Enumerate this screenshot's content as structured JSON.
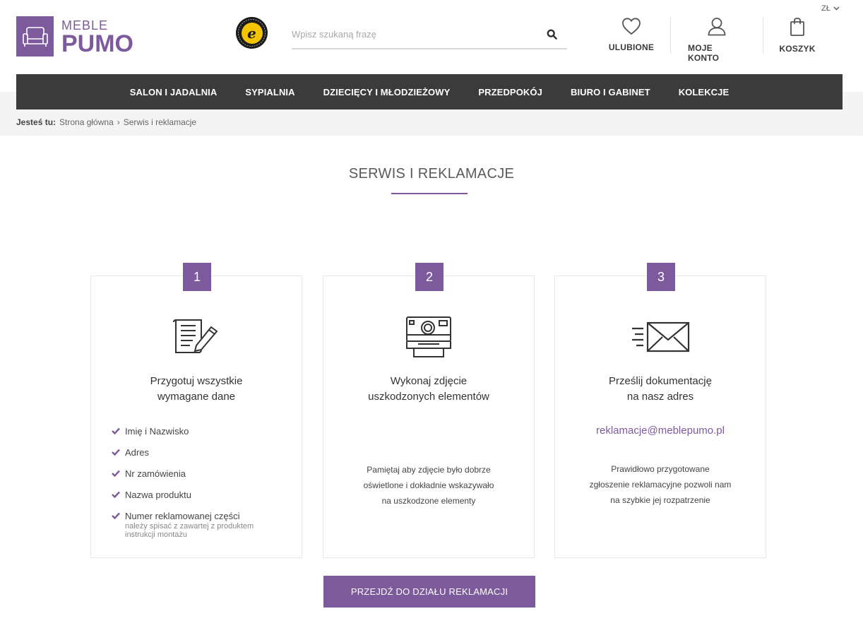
{
  "logo": {
    "line1": "MEBLE",
    "line2": "PUMO"
  },
  "trusted_badge": {
    "letter": "e"
  },
  "search": {
    "placeholder": "Wpisz szukaną frazę",
    "value": ""
  },
  "currency": {
    "label": "ZŁ"
  },
  "header_actions": [
    {
      "label": "ULUBIONE",
      "icon": "heart-icon"
    },
    {
      "label": "MOJE KONTO",
      "icon": "user-icon"
    },
    {
      "label": "KOSZYK",
      "icon": "shopping-bag-icon"
    }
  ],
  "nav": [
    "SALON I JADALNIA",
    "SYPIALNIA",
    "DZIECIĘCY I MŁODZIEŻOWY",
    "PRZEDPOKÓJ",
    "BIURO I GABINET",
    "KOLEKCJE"
  ],
  "breadcrumb": {
    "lead": "Jesteś tu:",
    "home": "Strona główna",
    "sep": "›",
    "current": "Serwis i reklamacje"
  },
  "page_title": "SERWIS I REKLAMACJE",
  "steps": [
    {
      "number": "1",
      "icon": "document-edit-icon",
      "title_line1": "Przygotuj wszystkie",
      "title_line2": "wymagane dane",
      "items": [
        {
          "text": "Imię i Nazwisko"
        },
        {
          "text": "Adres"
        },
        {
          "text": "Nr zamówienia"
        },
        {
          "text": "Nazwa produktu"
        },
        {
          "text": "Numer reklamowanej części",
          "sub1": "należy spisać z zawartej z produktem",
          "sub2": "instrukcji montażu"
        }
      ]
    },
    {
      "number": "2",
      "icon": "instant-camera-icon",
      "title_line1": "Wykonaj zdjęcie",
      "title_line2": "uszkodzonych elementów",
      "note": [
        "Pamiętaj aby zdjęcie było dobrze",
        "oświetlone  i dokładnie wskazywało",
        "na uszkodzone elementy"
      ]
    },
    {
      "number": "3",
      "icon": "envelope-send-icon",
      "title_line1": "Prześlij  dokumentację",
      "title_line2": "na nasz adres",
      "email": "reklamacje@meblepumo.pl",
      "note": [
        "Prawidłowo przygotowane",
        "zgłoszenie reklamacyjne pozwoli nam",
        "na szybkie jej rozpatrzenie"
      ]
    }
  ],
  "cta": {
    "label": "PRZEJDŹ DO DZIAŁU REKLAMACJI"
  },
  "colors": {
    "brand": "#7d5a9c",
    "nav_bg": "#3b3b3b",
    "breadcrumb_bg": "#f4f4f4"
  }
}
